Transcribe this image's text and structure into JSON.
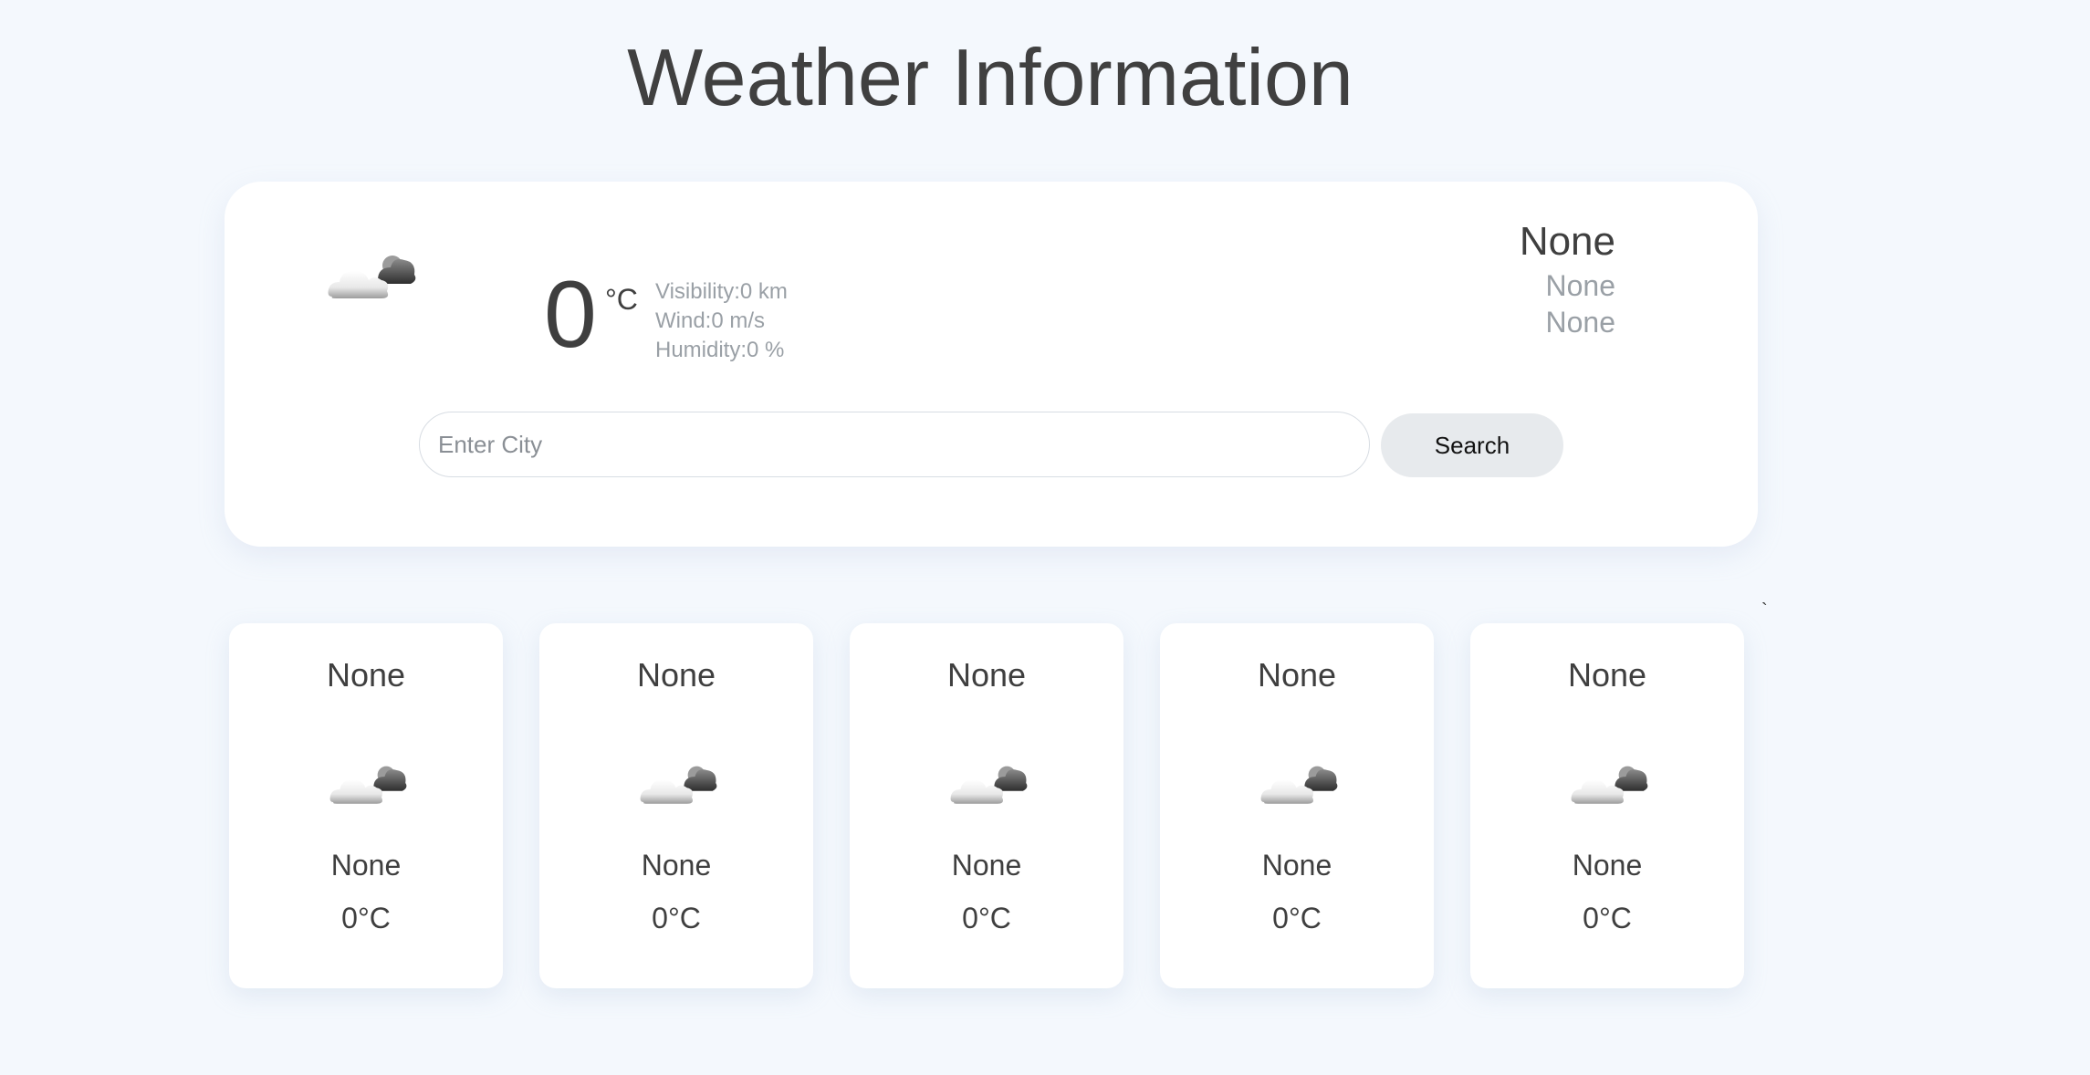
{
  "page": {
    "title": "Weather Information"
  },
  "current": {
    "icon": "cloud-sun-icon",
    "temperature": "0",
    "unit": "°C",
    "visibility": "Visibility:0 km",
    "wind": "Wind:0 m/s",
    "humidity": "Humidity:0 %"
  },
  "location": {
    "city": "None",
    "line2": "None",
    "line3": "None"
  },
  "search": {
    "placeholder": "Enter City",
    "value": "",
    "button_label": "Search"
  },
  "stray_mark": "`",
  "forecast": [
    {
      "day": "None",
      "icon": "cloud-sun-icon",
      "description": "None",
      "temperature": "0°C"
    },
    {
      "day": "None",
      "icon": "cloud-sun-icon",
      "description": "None",
      "temperature": "0°C"
    },
    {
      "day": "None",
      "icon": "cloud-sun-icon",
      "description": "None",
      "temperature": "0°C"
    },
    {
      "day": "None",
      "icon": "cloud-sun-icon",
      "description": "None",
      "temperature": "0°C"
    },
    {
      "day": "None",
      "icon": "cloud-sun-icon",
      "description": "None",
      "temperature": "0°C"
    }
  ],
  "colors": {
    "background": "#f4f8fd",
    "card": "#ffffff",
    "muted_text": "#9aa0a6",
    "button": "#e7eaed"
  }
}
